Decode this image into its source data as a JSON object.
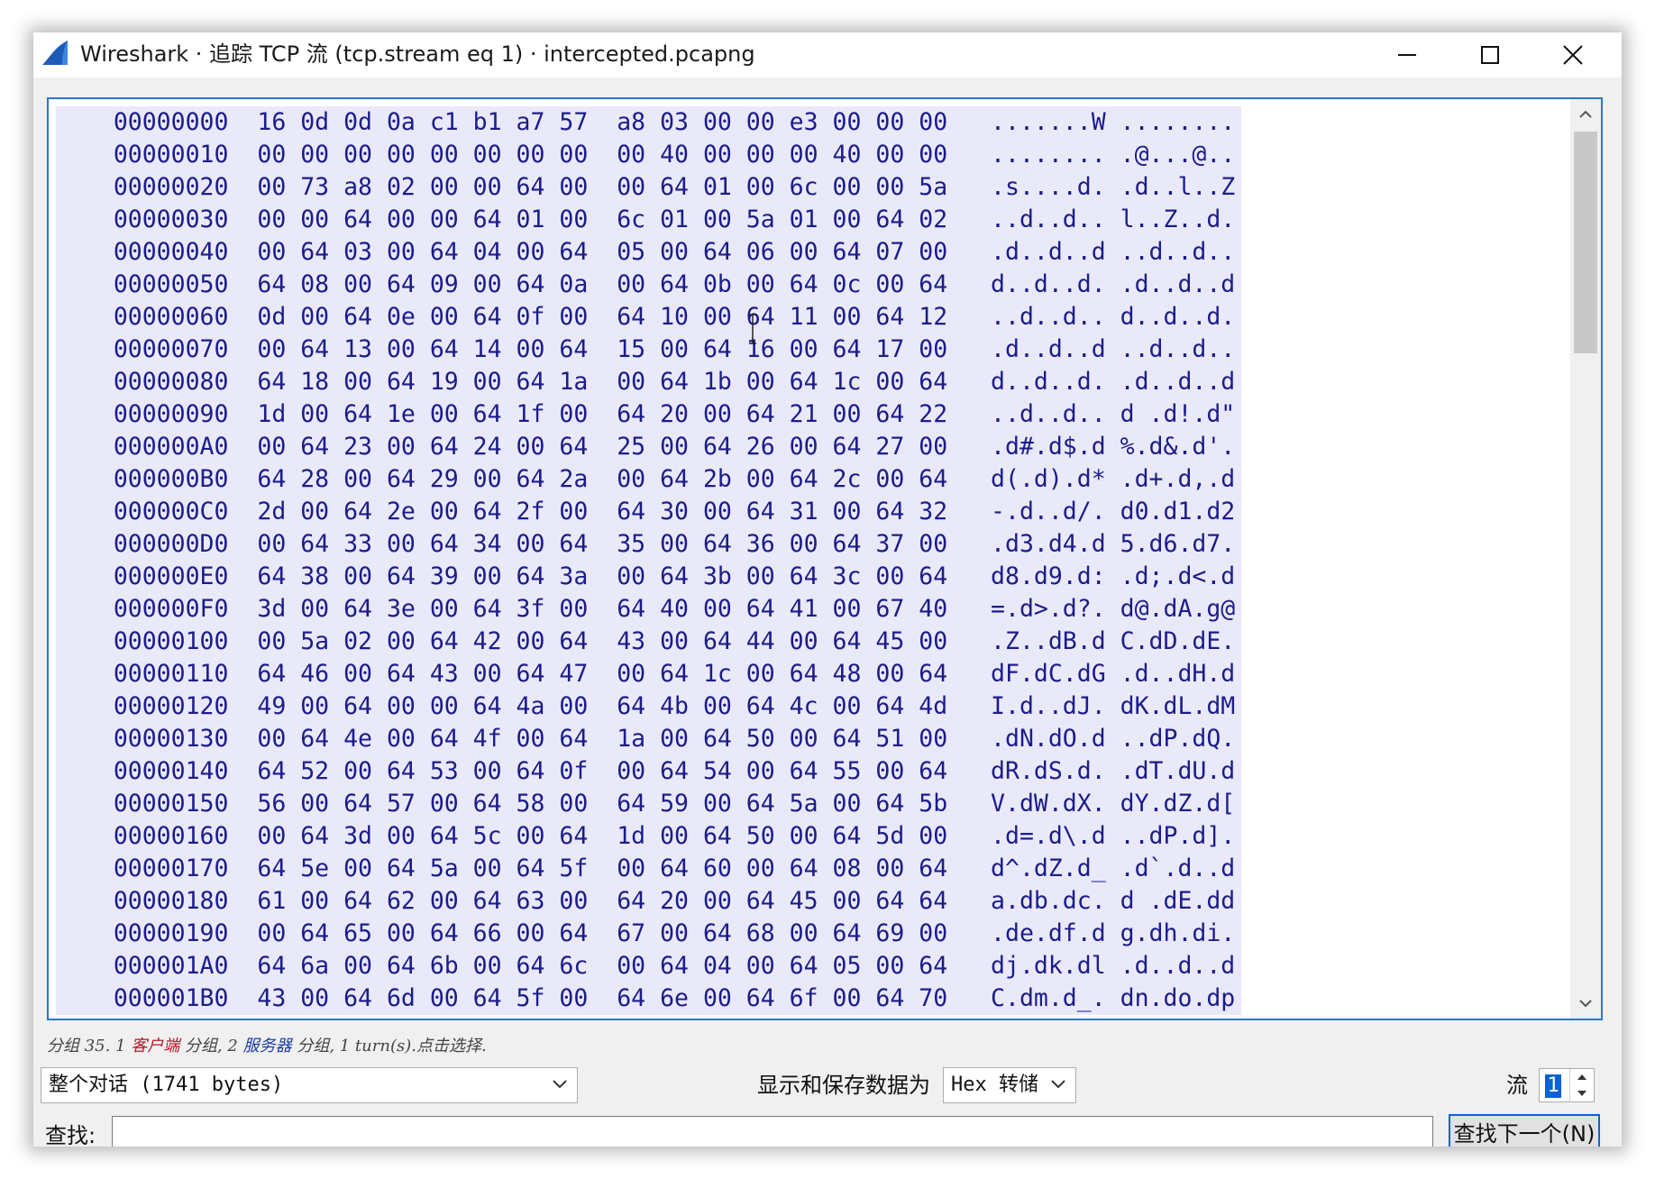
{
  "window": {
    "title": "Wireshark · 追踪 TCP 流 (tcp.stream eq 1) · intercepted.pcapng",
    "icon": "wireshark-fin-icon"
  },
  "hex_dump": {
    "rows": [
      "    00000000  16 0d 0d 0a c1 b1 a7 57  a8 03 00 00 e3 00 00 00   .......W ........",
      "    00000010  00 00 00 00 00 00 00 00  00 40 00 00 00 40 00 00   ........ .@...@..",
      "    00000020  00 73 a8 02 00 00 64 00  00 64 01 00 6c 00 00 5a   .s....d. .d..l..Z",
      "    00000030  00 00 64 00 00 64 01 00  6c 01 00 5a 01 00 64 02   ..d..d.. l..Z..d.",
      "    00000040  00 64 03 00 64 04 00 64  05 00 64 06 00 64 07 00   .d..d..d ..d..d..",
      "    00000050  64 08 00 64 09 00 64 0a  00 64 0b 00 64 0c 00 64   d..d..d. .d..d..d",
      "    00000060  0d 00 64 0e 00 64 0f 00  64 10 00 64 11 00 64 12   ..d..d.. d..d..d.",
      "    00000070  00 64 13 00 64 14 00 64  15 00 64 16 00 64 17 00   .d..d..d ..d..d..",
      "    00000080  64 18 00 64 19 00 64 1a  00 64 1b 00 64 1c 00 64   d..d..d. .d..d..d",
      "    00000090  1d 00 64 1e 00 64 1f 00  64 20 00 64 21 00 64 22   ..d..d.. d .d!.d\"",
      "    000000A0  00 64 23 00 64 24 00 64  25 00 64 26 00 64 27 00   .d#.d$.d %.d&.d'.",
      "    000000B0  64 28 00 64 29 00 64 2a  00 64 2b 00 64 2c 00 64   d(.d).d* .d+.d,.d",
      "    000000C0  2d 00 64 2e 00 64 2f 00  64 30 00 64 31 00 64 32   -.d..d/. d0.d1.d2",
      "    000000D0  00 64 33 00 64 34 00 64  35 00 64 36 00 64 37 00   .d3.d4.d 5.d6.d7.",
      "    000000E0  64 38 00 64 39 00 64 3a  00 64 3b 00 64 3c 00 64   d8.d9.d: .d;.d<.d",
      "    000000F0  3d 00 64 3e 00 64 3f 00  64 40 00 64 41 00 67 40   =.d>.d?. d@.dA.g@",
      "    00000100  00 5a 02 00 64 42 00 64  43 00 64 44 00 64 45 00   .Z..dB.d C.dD.dE.",
      "    00000110  64 46 00 64 43 00 64 47  00 64 1c 00 64 48 00 64   dF.dC.dG .d..dH.d",
      "    00000120  49 00 64 00 00 64 4a 00  64 4b 00 64 4c 00 64 4d   I.d..dJ. dK.dL.dM",
      "    00000130  00 64 4e 00 64 4f 00 64  1a 00 64 50 00 64 51 00   .dN.dO.d ..dP.dQ.",
      "    00000140  64 52 00 64 53 00 64 0f  00 64 54 00 64 55 00 64   dR.dS.d. .dT.dU.d",
      "    00000150  56 00 64 57 00 64 58 00  64 59 00 64 5a 00 64 5b   V.dW.dX. dY.dZ.d[",
      "    00000160  00 64 3d 00 64 5c 00 64  1d 00 64 50 00 64 5d 00   .d=.d\\.d ..dP.d].",
      "    00000170  64 5e 00 64 5a 00 64 5f  00 64 60 00 64 08 00 64   d^.dZ.d_ .d`.d..d",
      "    00000180  61 00 64 62 00 64 63 00  64 20 00 64 45 00 64 64   a.db.dc. d .dE.dd",
      "    00000190  00 64 65 00 64 66 00 64  67 00 64 68 00 64 69 00   .de.df.d g.dh.di.",
      "    000001A0  64 6a 00 64 6b 00 64 6c  00 64 04 00 64 05 00 64   dj.dk.dl .d..d..d",
      "    000001B0  43 00 64 6d 00 64 5f 00  64 6e 00 64 6f 00 64 70   C.dm.d_. dn.do.dp"
    ]
  },
  "status": {
    "prefix": "分组 35. 1 ",
    "client": "客户端",
    "mid": " 分组, 2 ",
    "server": "服务器",
    "suffix": " 分组, 1 turn(s).点击选择."
  },
  "conversation_select": {
    "value": "整个对话 (1741 bytes)"
  },
  "display_as": {
    "label": "显示和保存数据为",
    "value": "Hex 转储"
  },
  "stream": {
    "label": "流",
    "value": "1"
  },
  "find": {
    "label": "查找:",
    "value": "",
    "button": "查找下一个(N)"
  },
  "colors": {
    "accent": "#0a62d3",
    "hex_text": "#1c1c8a",
    "hex_bg": "#e9e9fa",
    "client": "#b0172a",
    "server": "#1a3aa6"
  }
}
